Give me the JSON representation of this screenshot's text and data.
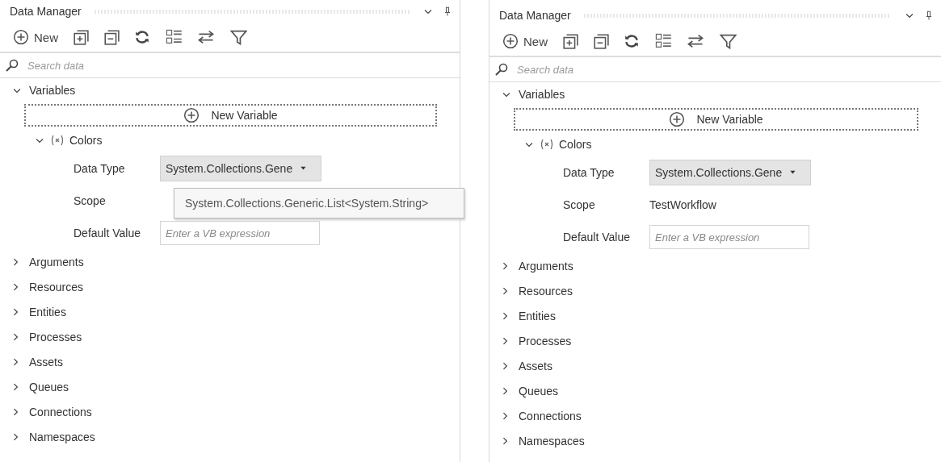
{
  "panels": [
    {
      "title": "Data Manager",
      "toolbar": {
        "new_label": "New"
      },
      "search": {
        "placeholder": "Search data"
      },
      "variables": {
        "label": "Variables",
        "expanded": true,
        "new_variable": "New Variable",
        "items": [
          {
            "name": "Colors",
            "expanded": true,
            "fields": [
              {
                "kind": "dropdown",
                "label": "Data Type",
                "value": "System.Collections.Gene",
                "tooltip": "System.Collections.Generic.List<System.String>"
              },
              {
                "kind": "text",
                "label": "Scope"
              },
              {
                "kind": "input",
                "label": "Default Value",
                "placeholder": "Enter a VB expression"
              }
            ]
          }
        ]
      },
      "sections": [
        {
          "label": "Arguments",
          "expanded": false
        },
        {
          "label": "Resources",
          "expanded": false
        },
        {
          "label": "Entities",
          "expanded": false
        },
        {
          "label": "Processes",
          "expanded": false
        },
        {
          "label": "Assets",
          "expanded": false
        },
        {
          "label": "Queues",
          "expanded": false
        },
        {
          "label": "Connections",
          "expanded": false
        },
        {
          "label": "Namespaces",
          "expanded": false
        }
      ]
    },
    {
      "title": "Data Manager",
      "toolbar": {
        "new_label": "New"
      },
      "search": {
        "placeholder": "Search data"
      },
      "variables": {
        "label": "Variables",
        "expanded": true,
        "new_variable": "New Variable",
        "items": [
          {
            "name": "Colors",
            "expanded": true,
            "fields": [
              {
                "kind": "dropdown",
                "label": "Data Type",
                "value": "System.Collections.Gene"
              },
              {
                "kind": "text",
                "label": "Scope",
                "value": "TestWorkflow"
              },
              {
                "kind": "input",
                "label": "Default Value",
                "placeholder": "Enter a VB expression"
              }
            ]
          }
        ]
      },
      "sections": [
        {
          "label": "Arguments",
          "expanded": false
        },
        {
          "label": "Resources",
          "expanded": false
        },
        {
          "label": "Entities",
          "expanded": false
        },
        {
          "label": "Processes",
          "expanded": false
        },
        {
          "label": "Assets",
          "expanded": false
        },
        {
          "label": "Queues",
          "expanded": false
        },
        {
          "label": "Connections",
          "expanded": false
        },
        {
          "label": "Namespaces",
          "expanded": false
        }
      ]
    }
  ]
}
